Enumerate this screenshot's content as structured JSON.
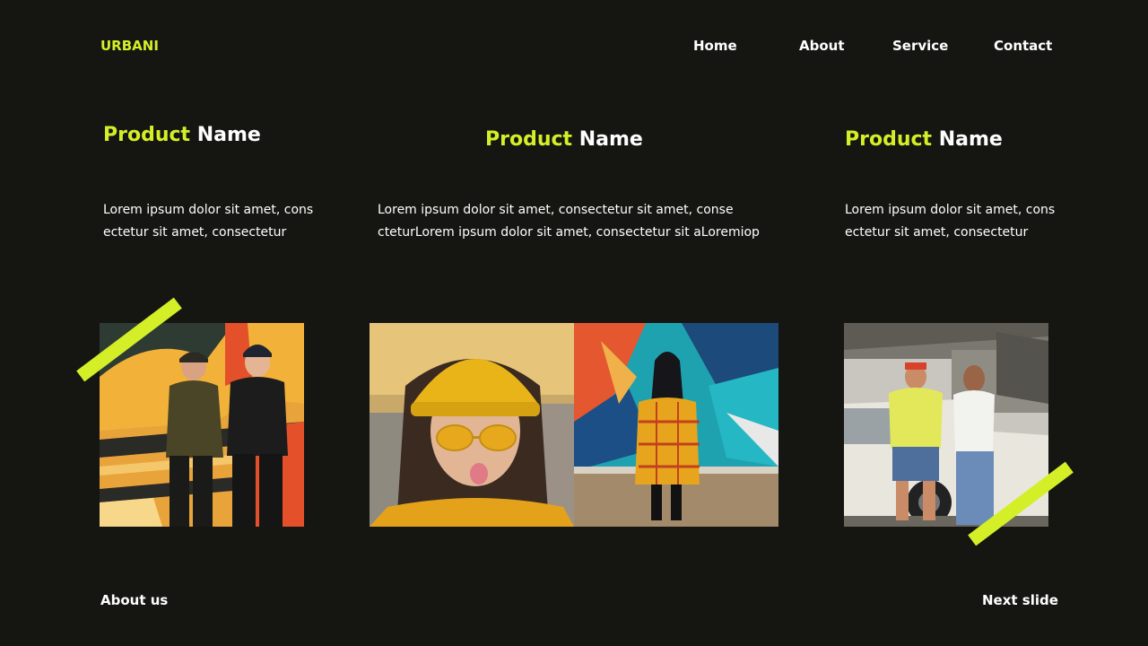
{
  "brand": "URBANI",
  "nav": {
    "home": "Home",
    "about": "About",
    "service": "Service",
    "contact": "Contact"
  },
  "products": [
    {
      "title_highlight": "Product",
      "title_rest": " Name",
      "desc_line1": "Lorem ipsum dolor sit amet, cons",
      "desc_line2": "ectetur sit amet, consectetur"
    },
    {
      "title_highlight": "Product",
      "title_rest": " Name",
      "desc_line1": "Lorem ipsum dolor sit amet, consectetur sit amet, conse",
      "desc_line2": "cteturLorem ipsum dolor sit amet, consectetur sit aLoremiop"
    },
    {
      "title_highlight": "Product",
      "title_rest": " Name",
      "desc_line1": "Lorem ipsum dolor sit amet, cons",
      "desc_line2": "ectetur sit amet, consectetur"
    }
  ],
  "footer": {
    "about_us": "About us",
    "next_slide": "Next slide"
  },
  "colors": {
    "background": "#151512",
    "accent": "#d4ef27",
    "text": "#ffffff"
  }
}
